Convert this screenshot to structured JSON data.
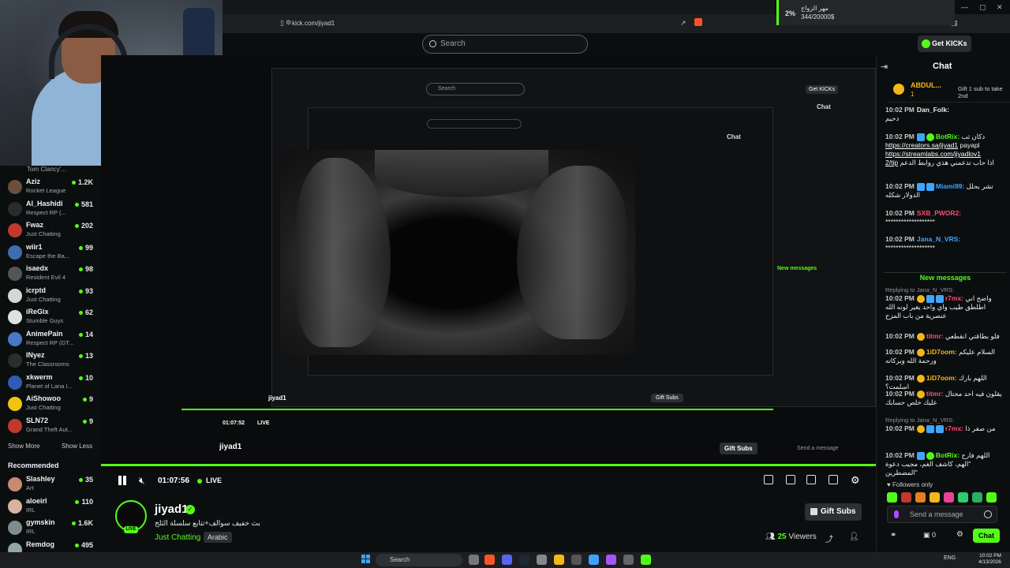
{
  "browser": {
    "url": "kick.com/jiyad1"
  },
  "sub_goal": {
    "percent": "2%",
    "label": "مهر الزواج",
    "progress_text": "344/20000$",
    "progress_fraction": 0.02
  },
  "header": {
    "search_placeholder": "Search",
    "get_kicks_label": "Get KICKs"
  },
  "sidebar": {
    "top_game": "Tom Clancy'...",
    "channels": [
      {
        "name": "Aziz",
        "game": "Rocket League",
        "viewers": "1.2K",
        "color": "#6b4f3a"
      },
      {
        "name": "Al_Hashidi",
        "game": "Respect RP (...",
        "viewers": "581",
        "color": "#2b2b2b"
      },
      {
        "name": "Fwaz",
        "game": "Just Chatting",
        "viewers": "202",
        "color": "#c0392b"
      },
      {
        "name": "wiir1",
        "game": "Escape the Ba...",
        "viewers": "99",
        "color": "#3d6fb0"
      },
      {
        "name": "isaedx",
        "game": "Resident Evil 4",
        "viewers": "98",
        "color": "#555555"
      },
      {
        "name": "icrptd",
        "game": "Just Chatting",
        "viewers": "93",
        "color": "#d7d7d7"
      },
      {
        "name": "iReGix",
        "game": "Stumble Guys",
        "viewers": "62",
        "color": "#e0e0e0"
      },
      {
        "name": "AnimePain",
        "game": "Respect RP (GT...",
        "viewers": "14",
        "color": "#4a78c8"
      },
      {
        "name": "INyez",
        "game": "The Classrooms",
        "viewers": "13",
        "color": "#2d2d2d"
      },
      {
        "name": "xkwerm",
        "game": "Planet of Lana I...",
        "viewers": "10",
        "color": "#2f5ab5"
      },
      {
        "name": "AiShowoo",
        "game": "Just Chatting",
        "viewers": "9",
        "color": "#f1c40f"
      },
      {
        "name": "SLN72",
        "game": "Grand Theft Aut...",
        "viewers": "9",
        "color": "#c0392b"
      }
    ],
    "show_more": "Show More",
    "show_less": "Show Less",
    "recommended_heading": "Recommended",
    "recommended": [
      {
        "name": "Slashley",
        "game": "Art",
        "viewers": "35",
        "color": "#c98a74"
      },
      {
        "name": "aloeirl",
        "game": "IRL",
        "viewers": "110",
        "color": "#d8b4a0"
      },
      {
        "name": "gymskin",
        "game": "IRL",
        "viewers": "1.6K",
        "color": "#7f8c8d"
      },
      {
        "name": "Remdog",
        "game": "",
        "viewers": "495",
        "color": "#95a5a6"
      }
    ]
  },
  "nested": {
    "chat_title": "Chat",
    "get_kicks": "Get KICKs",
    "search": "Search",
    "new_messages": "New messages",
    "gift_subs": "Gift Subs",
    "send_message": "Send a message",
    "followers_only": "Followers only",
    "streamer": "jiyad1",
    "time": "01:07:52",
    "live": "LIVE"
  },
  "player": {
    "timecode": "01:07:56",
    "live": "LIVE"
  },
  "stream": {
    "streamer": "jiyad1",
    "title": "بث خفيف سوالف+تتابع سلسلة الثلج",
    "category": "Just Chatting",
    "language": "Arabic",
    "gift_subs": "Gift Subs",
    "viewers": "25",
    "viewers_label": "Viewers",
    "live_pill": "LIVE"
  },
  "chat": {
    "title": "Chat",
    "pinned": {
      "user": "ABDUL...",
      "count": "1",
      "gift_text": "Gift 1 sub to take 2nd"
    },
    "messages": [
      {
        "ts": "10:02 PM",
        "user": "Dan_Folk:",
        "text": "دحيم",
        "color": "#e8e8e8"
      },
      {
        "ts": "10:02 PM",
        "user": "BotRix:",
        "text": "دكان ثب",
        "color": "#53fc18",
        "links": [
          "https://creators.sa/jiyad1",
          "https://streamlabs.com/jiyadlov1",
          "2/tip"
        ],
        "extra1": "payapl",
        "extra2": "اذا حاب تدعمني هذي روابط الدعم"
      },
      {
        "ts": "10:02 PM",
        "user": "Miami99:",
        "text": "تشر بحلل الدولار شكله",
        "color": "#3ea6ff"
      },
      {
        "ts": "10:02 PM",
        "user": "SXB_PWOR2:",
        "text": "*******************",
        "color": "#ff4d6d"
      },
      {
        "ts": "10:02 PM",
        "user": "Jana_N_VRS:",
        "text": "*******************",
        "color": "#3ea6ff"
      }
    ],
    "new_messages": "New messages",
    "messages2": [
      {
        "reply": "Replying to Jana_N_VRS:",
        "ts": "10:02 PM",
        "user": "r7mx:",
        "text": "واضح اني اطلطق طيب واي واحد يغير لونه الله عنصرية من باب المزح",
        "color": "#ff4d6d"
      },
      {
        "ts": "10:02 PM",
        "user": "titmr:",
        "text": "فلو بطاقتي انقطعي",
        "color": "#ff4d6d"
      },
      {
        "ts": "10:02 PM",
        "user": "1iD7oom:",
        "text": "السلام عليكم ورحمة الله وبركاته",
        "color": "#f5b617"
      },
      {
        "ts": "10:02 PM",
        "user": "1iD7oom:",
        "text": "اللهم بارك اسلمت؟",
        "color": "#f5b617"
      },
      {
        "ts": "10:02 PM",
        "user": "titmr:",
        "text": "يقلون فيه احد محتال عليك خلص حسابك",
        "color": "#ff4d6d"
      },
      {
        "reply": "Replying to Jana_N_VRS:",
        "ts": "10:02 PM",
        "user": "r7mx:",
        "text": "من صفر ذا",
        "color": "#ff4d6d"
      },
      {
        "ts": "10:02 PM",
        "user": "BotRix:",
        "text": "اللهم فارج \"الهم، كاشف الغم، مجيب دعوة المضطرين\"",
        "color": "#53fc18"
      }
    ],
    "followers_only": "Followers only",
    "send_placeholder": "Send a message",
    "points": "0",
    "send_label": "Chat"
  },
  "taskbar": {
    "search": "Search",
    "time": "10:02 PM",
    "date": "4/13/2026",
    "lang": "ENG"
  }
}
